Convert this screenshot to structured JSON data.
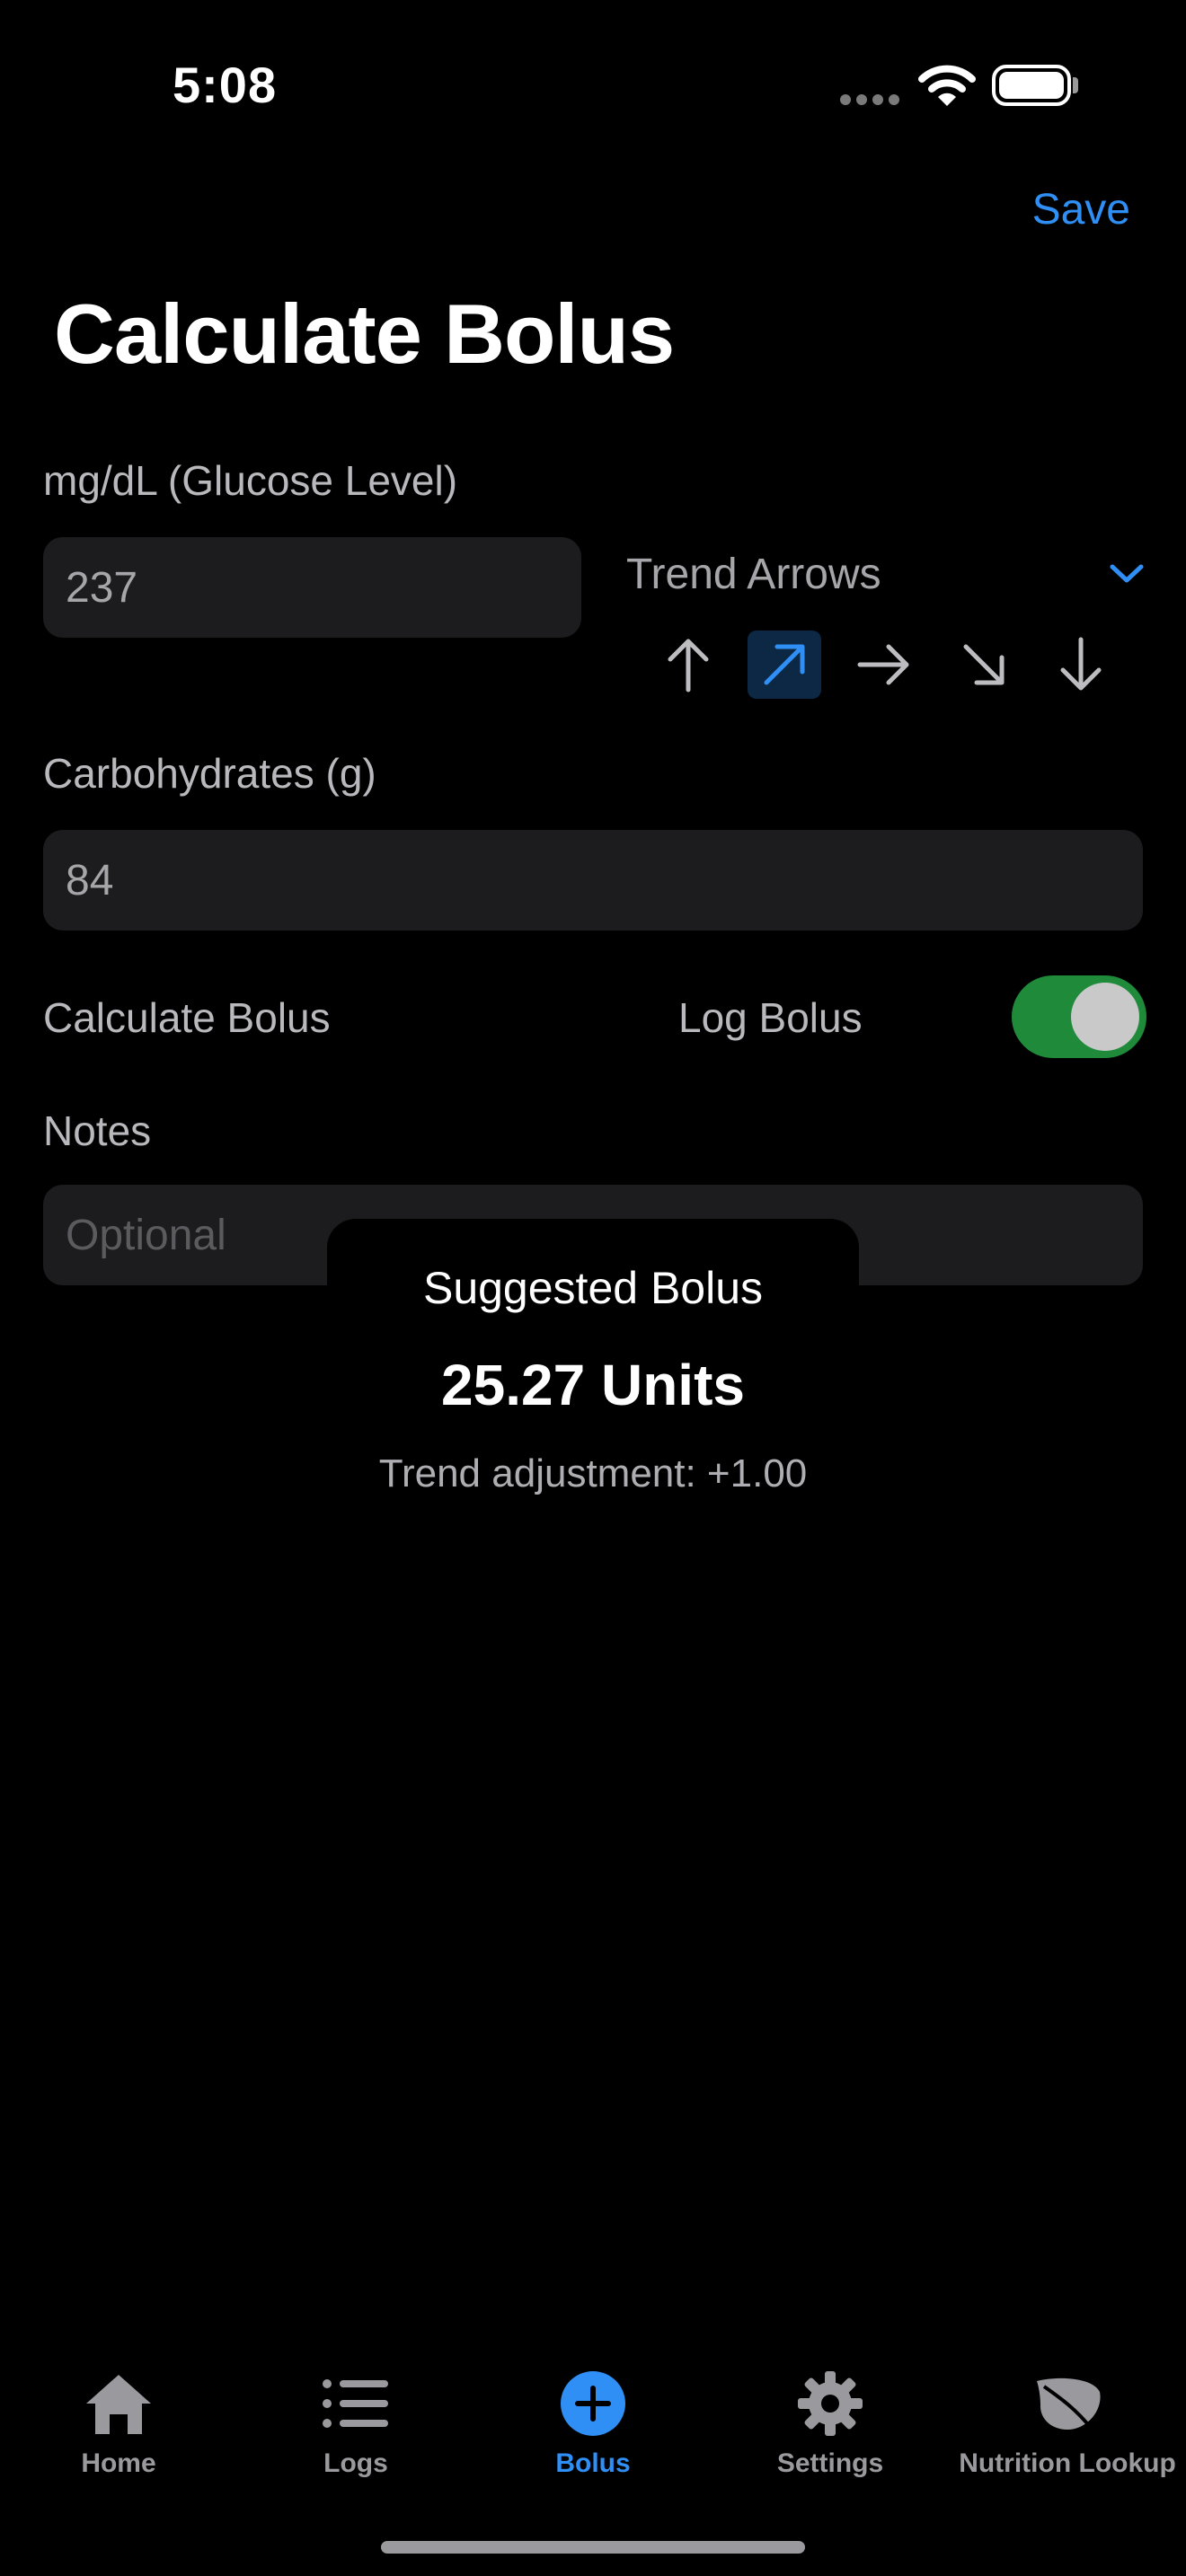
{
  "status_bar": {
    "time": "5:08"
  },
  "nav": {
    "save_label": "Save",
    "title": "Calculate Bolus"
  },
  "glucose": {
    "label": "mg/dL (Glucose Level)",
    "value": "237"
  },
  "trend": {
    "label": "Trend Arrows",
    "arrows": [
      "arrow-up-icon",
      "arrow-up-right-icon",
      "arrow-right-icon",
      "arrow-down-right-icon",
      "arrow-down-icon"
    ],
    "selected": "arrow-up-right-icon"
  },
  "carbs": {
    "label": "Carbohydrates (g)",
    "value": "84"
  },
  "calculate": {
    "label": "Calculate Bolus"
  },
  "log_bolus": {
    "label": "Log Bolus",
    "on": true
  },
  "notes": {
    "label": "Notes",
    "placeholder": "Optional"
  },
  "suggestion": {
    "title": "Suggested Bolus",
    "value": "25.27 Units",
    "note": "Trend adjustment: +1.00"
  },
  "tabs": [
    {
      "label": "Home",
      "icon": "house-icon"
    },
    {
      "label": "Logs",
      "icon": "list-icon"
    },
    {
      "label": "Bolus",
      "icon": "plus-circle-icon",
      "active": true
    },
    {
      "label": "Settings",
      "icon": "gear-icon"
    },
    {
      "label": "Nutrition Lookup",
      "icon": "leaf-icon"
    }
  ],
  "colors": {
    "accent": "#2f8ff5",
    "toggle_on": "#1f8a3a",
    "field_bg": "#1c1c1e"
  }
}
